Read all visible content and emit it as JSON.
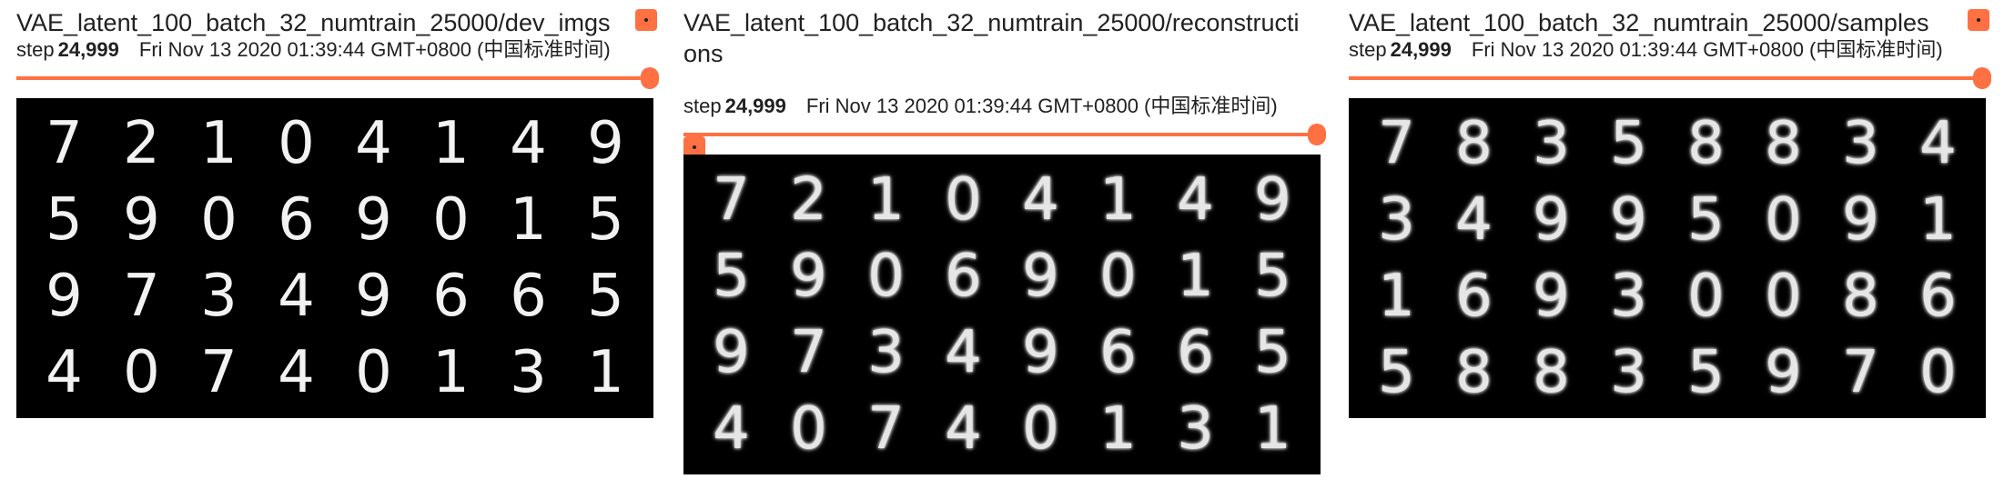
{
  "colors": {
    "accent": "#ff7043",
    "image_bg": "#000000"
  },
  "cards": [
    {
      "title": "VAE_latent_100_batch_32_numtrain_25000/dev_imgs",
      "step_label": "step",
      "step_value": "24,999",
      "timestamp": "Fri Nov 13 2020 01:39:44 GMT+0800 (中国标准时间)",
      "slider_fraction": 1.0,
      "digits": [
        "7",
        "2",
        "1",
        "0",
        "4",
        "1",
        "4",
        "9",
        "5",
        "9",
        "0",
        "6",
        "9",
        "0",
        "1",
        "5",
        "9",
        "7",
        "3",
        "4",
        "9",
        "6",
        "6",
        "5",
        "4",
        "0",
        "7",
        "4",
        "0",
        "1",
        "3",
        "1"
      ]
    },
    {
      "title": "VAE_latent_100_batch_32_numtrain_25000/reconstructions",
      "step_label": "step",
      "step_value": "24,999",
      "timestamp": "Fri Nov 13 2020 01:39:44 GMT+0800 (中国标准时间)",
      "slider_fraction": 1.0,
      "digits": [
        "7",
        "2",
        "1",
        "0",
        "4",
        "1",
        "4",
        "9",
        "5",
        "9",
        "0",
        "6",
        "9",
        "0",
        "1",
        "5",
        "9",
        "7",
        "3",
        "4",
        "9",
        "6",
        "6",
        "5",
        "4",
        "0",
        "7",
        "4",
        "0",
        "1",
        "3",
        "1"
      ]
    },
    {
      "title": "VAE_latent_100_batch_32_numtrain_25000/samples",
      "step_label": "step",
      "step_value": "24,999",
      "timestamp": "Fri Nov 13 2020 01:39:44 GMT+0800 (中国标准时间)",
      "slider_fraction": 1.0,
      "digits": [
        "7",
        "8",
        "3",
        "5",
        "8",
        "8",
        "3",
        "4",
        "3",
        "4",
        "9",
        "9",
        "5",
        "0",
        "9",
        "1",
        "1",
        "6",
        "9",
        "3",
        "0",
        "0",
        "8",
        "6",
        "5",
        "8",
        "8",
        "3",
        "5",
        "9",
        "7",
        "0"
      ]
    }
  ]
}
